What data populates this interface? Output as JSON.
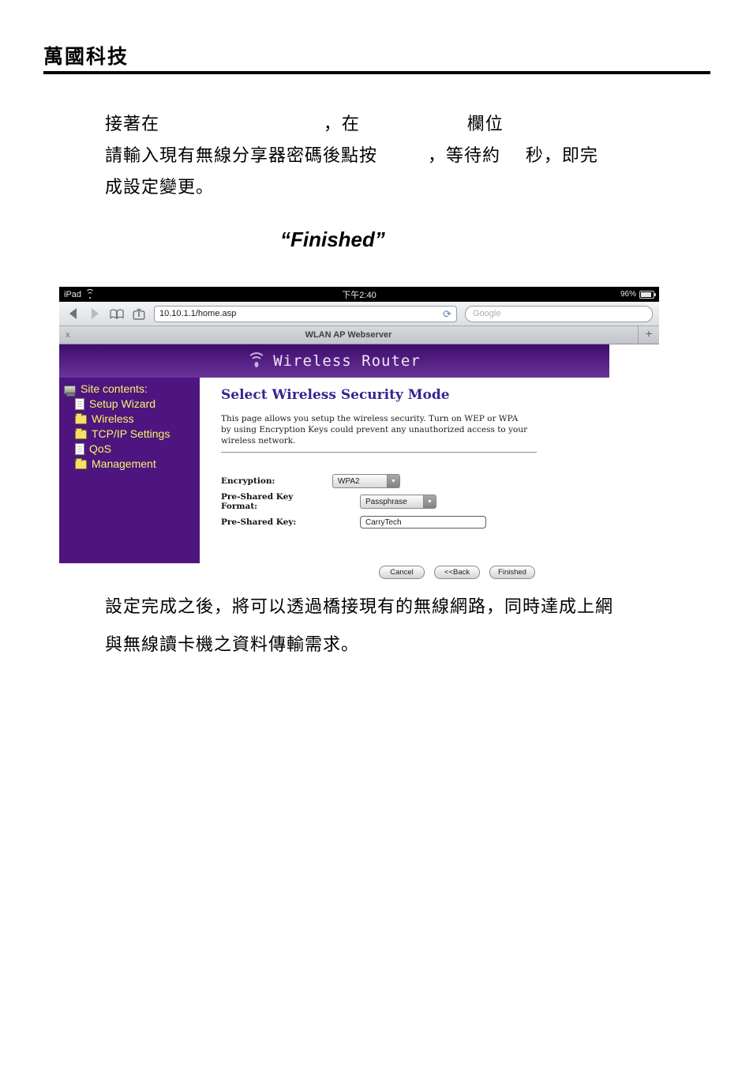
{
  "document": {
    "header_title": "萬國科技",
    "paragraph_top": "接著在                          ，在                 欄位\n請輸入現有無線分享器密碼後點按        ，等待約    秒，即完\n成設定變更。",
    "finished_caption": "“Finished”",
    "paragraph_bottom": "設定完成之後，將可以透過橋接現有的無線網路，同時達成上網\n與無線讀卡機之資料傳輸需求。"
  },
  "screenshot": {
    "status_bar": {
      "device": "iPad",
      "wifi_icon": "wifi-icon",
      "time": "下午2:40",
      "battery_percent": "96%",
      "battery_icon": "battery-icon"
    },
    "browser": {
      "back_icon": "back-arrow-icon",
      "forward_icon": "forward-arrow-icon",
      "bookmarks_icon": "book-icon",
      "share_icon": "share-icon",
      "url": "10.10.1.1/home.asp",
      "reload_icon": "reload-icon",
      "search_placeholder": "Google",
      "tab_close_label": "x",
      "tab_title": "WLAN AP Webserver",
      "new_tab_label": "+"
    },
    "banner": {
      "wifi_icon": "wifi-signal-icon",
      "title": "Wireless Router"
    },
    "sidebar": {
      "root_label": "Site contents:",
      "root_icon": "computer-icon",
      "items": [
        {
          "label": "Setup Wizard",
          "icon": "page-icon"
        },
        {
          "label": "Wireless",
          "icon": "folder-icon"
        },
        {
          "label": "TCP/IP Settings",
          "icon": "folder-icon"
        },
        {
          "label": "QoS",
          "icon": "page-icon"
        },
        {
          "label": "Management",
          "icon": "folder-icon"
        }
      ]
    },
    "content": {
      "title": "Select Wireless Security Mode",
      "description": "This page allows you setup the wireless security. Turn on WEP or WPA by using Encryption Keys could prevent any unauthorized access to your wireless network.",
      "fields": [
        {
          "label": "Encryption:",
          "value": "WPA2",
          "type": "select"
        },
        {
          "label": "Pre-Shared Key Format:",
          "value": "Passphrase",
          "type": "select"
        },
        {
          "label": "Pre-Shared Key:",
          "value": "CarryTech",
          "type": "text"
        }
      ],
      "buttons": [
        {
          "label": "Cancel"
        },
        {
          "label": "<<Back"
        },
        {
          "label": "Finished"
        }
      ]
    }
  },
  "colors": {
    "sidebar_purple": "#4E1580",
    "banner_purple_dark": "#3D0D6B",
    "banner_purple_light": "#6B3399",
    "sidebar_link_yellow": "#F5F56A",
    "heading_purple": "#3B2391"
  }
}
